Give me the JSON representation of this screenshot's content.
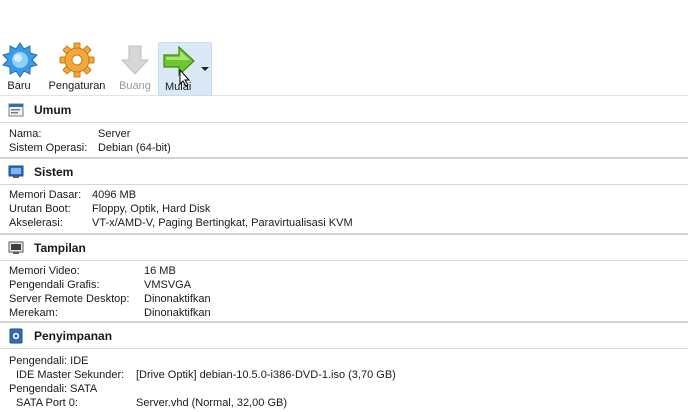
{
  "toolbar": {
    "new_label": "Baru",
    "settings_label": "Pengaturan",
    "discard_label": "Buang",
    "start_label": "Mulai"
  },
  "sections": {
    "general": {
      "title": "Umum",
      "rows": [
        {
          "key": "Nama:",
          "value": "Server"
        },
        {
          "key": "Sistem Operasi:",
          "value": "Debian (64-bit)"
        }
      ]
    },
    "system": {
      "title": "Sistem",
      "rows": [
        {
          "key": "Memori Dasar:",
          "value": "4096 MB"
        },
        {
          "key": "Urutan Boot:",
          "value": "Floppy, Optik, Hard Disk"
        },
        {
          "key": "Akselerasi:",
          "value": "VT-x/AMD-V, Paging Bertingkat, Paravirtualisasi KVM"
        }
      ]
    },
    "display": {
      "title": "Tampilan",
      "rows": [
        {
          "key": "Memori Video:",
          "value": "16 MB"
        },
        {
          "key": "Pengendali Grafis:",
          "value": "VMSVGA"
        },
        {
          "key": "Server Remote Desktop:",
          "value": "Dinonaktifkan"
        },
        {
          "key": "Merekam:",
          "value": "Dinonaktifkan"
        }
      ]
    },
    "storage": {
      "title": "Penyimpanan",
      "rows": [
        {
          "key": "Pengendali: IDE",
          "value": ""
        },
        {
          "key": "IDE Master Sekunder:",
          "value": "[Drive Optik] debian-10.5.0-i386-DVD-1.iso (3,70 GB)"
        },
        {
          "key": "Pengendali: SATA",
          "value": ""
        },
        {
          "key": "SATA Port 0:",
          "value": "Server.vhd (Normal, 32,00 GB)"
        }
      ]
    }
  }
}
